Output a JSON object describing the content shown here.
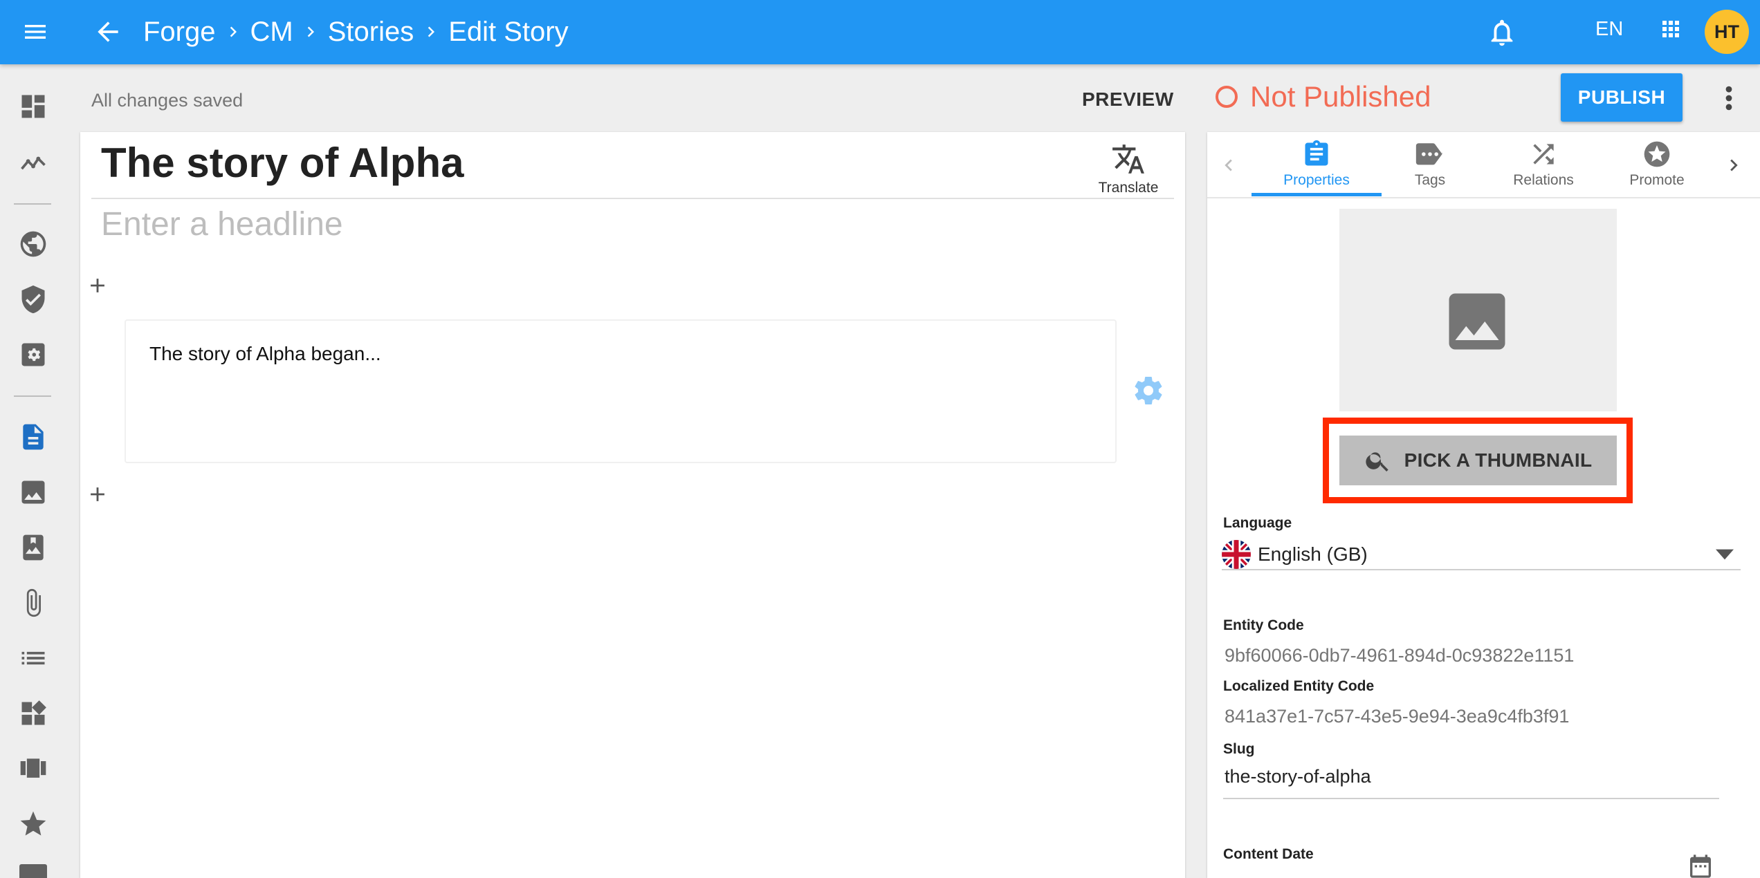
{
  "topbar": {
    "breadcrumbs": [
      "Forge",
      "CM",
      "Stories",
      "Edit Story"
    ],
    "language": "EN",
    "avatar_initials": "HT",
    "bar_color": "#2196f3",
    "avatar_color": "#fbc02d"
  },
  "rail": {
    "icons": [
      "dashboard-icon",
      "analytics-icon",
      "globe-icon",
      "shield-check-icon",
      "settings-box-icon",
      "document-icon",
      "image-icon",
      "photo-album-icon",
      "paperclip-icon",
      "list-icon",
      "widgets-icon",
      "carousel-icon",
      "star-icon"
    ]
  },
  "actionbar": {
    "save_status": "All changes saved",
    "preview_label": "PREVIEW",
    "publish_status": "Not Published",
    "publish_label": "PUBLISH",
    "status_color": "#f26b54"
  },
  "editor": {
    "title": "The story of Alpha",
    "translate_label": "Translate",
    "headline_placeholder": "Enter a headline",
    "paragraph_text": "The story of Alpha began..."
  },
  "sidepanel": {
    "tabs": [
      {
        "label": "Properties",
        "icon": "clipboard-icon",
        "active": true
      },
      {
        "label": "Tags",
        "icon": "tag-icon",
        "active": false
      },
      {
        "label": "Relations",
        "icon": "shuffle-icon",
        "active": false
      },
      {
        "label": "Promote",
        "icon": "star-badge-icon",
        "active": false
      }
    ],
    "thumbnail_button": "PICK A THUMBNAIL",
    "language_label": "Language",
    "language_value": "English (GB)",
    "entity_code_label": "Entity Code",
    "entity_code_value": "9bf60066-0db7-4961-894d-0c93822e1151",
    "localized_code_label": "Localized Entity Code",
    "localized_code_value": "841a37e1-7c57-43e5-9e94-3ea9c4fb3f91",
    "slug_label": "Slug",
    "slug_value": "the-story-of-alpha",
    "content_date_label": "Content Date",
    "highlight_color": "#ff2a00"
  }
}
